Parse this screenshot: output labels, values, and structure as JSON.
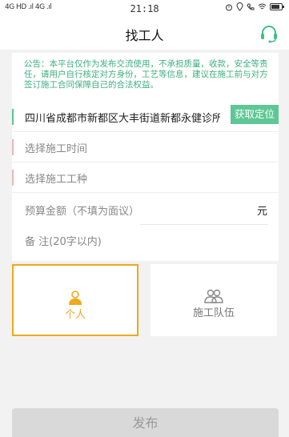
{
  "status_bar": {
    "network_left": "4G HD .ıl 4G .ıl",
    "time": "21:18"
  },
  "nav": {
    "title": "找工人",
    "service_icon": "headset-icon"
  },
  "notice": "公告：本平台仅作为发布交流使用，不承担质量，收款，安全等责任，请用户自行核定对方身份，工艺等信息，建议在施工前与对方签订施工合同保障自己的合法权益。",
  "form": {
    "address": "四川省成都市新都区大丰街道新都永健诊所",
    "locate_label": "获取定位",
    "time_placeholder": "选择施工时间",
    "trade_placeholder": "选择施工工种",
    "budget_placeholder": "预算金额（不填为面议）",
    "budget_unit": "元",
    "note_placeholder": "备 注(20字以内)"
  },
  "types": [
    {
      "label": "个人",
      "icon": "person-icon",
      "selected": true
    },
    {
      "label": "施工队伍",
      "icon": "team-icon",
      "selected": false
    }
  ],
  "submit_label": "发布",
  "colors": {
    "accent_green": "#5ec795",
    "selected_orange": "#f0a81c",
    "notice_green": "#3fae83"
  }
}
